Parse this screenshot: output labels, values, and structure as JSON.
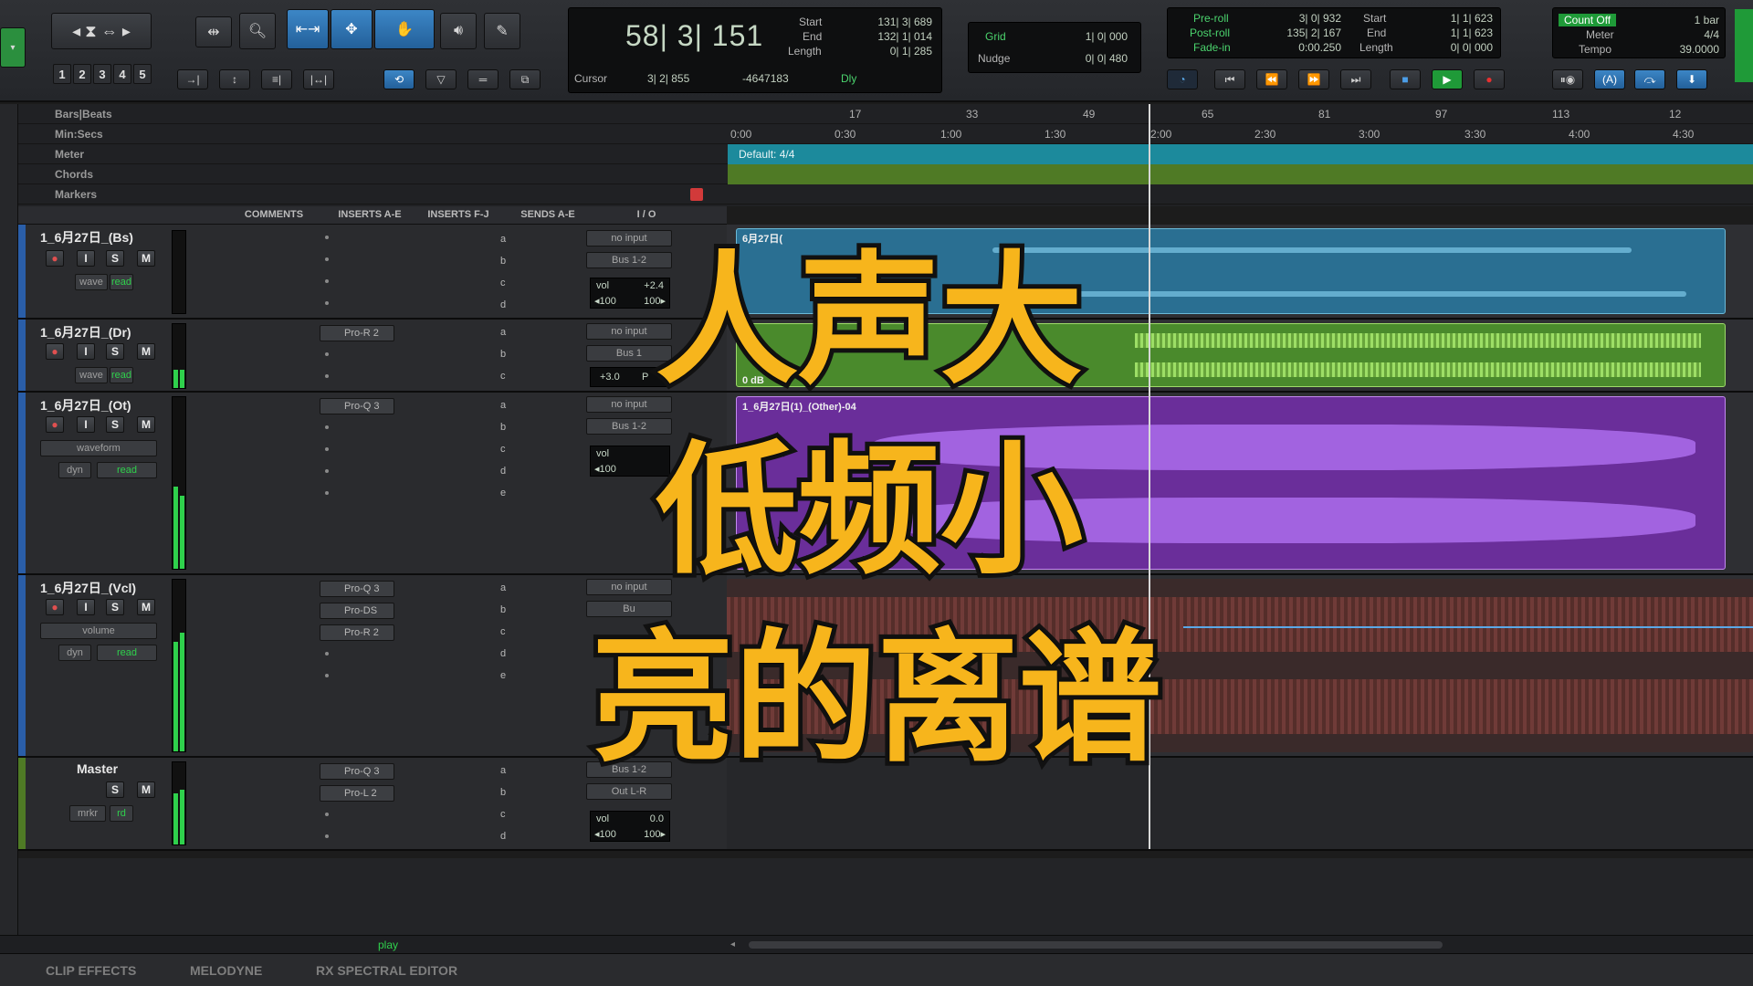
{
  "toolbar": {
    "numbers": [
      "1",
      "2",
      "3",
      "4",
      "5"
    ],
    "main_counter": "58| 3| 151",
    "start_label": "Start",
    "end_label": "End",
    "length_label": "Length",
    "start_value": "131| 3| 689",
    "end_value": "132| 1| 014",
    "length_value": "0| 1| 285",
    "cursor_label": "Cursor",
    "cursor_value": "3| 2| 855",
    "cursor_extra": "-4647183",
    "dly_label": "Dly",
    "grid_label": "Grid",
    "grid_value": "1| 0| 000",
    "nudge_label": "Nudge",
    "nudge_value": "0| 0| 480",
    "preroll_label": "Pre-roll",
    "preroll_value": "3| 0| 932",
    "postroll_label": "Post-roll",
    "postroll_value": "135| 2| 167",
    "fadein_label": "Fade-in",
    "fadein_value": "0:00.250",
    "start2_label": "Start",
    "start2_value": "1| 1| 623",
    "end2_label": "End",
    "end2_value": "1| 1| 623",
    "length2_label": "Length",
    "length2_value": "0| 0| 000",
    "count_off": "Count Off",
    "bar_value": "1 bar",
    "meter_label": "Meter",
    "meter_value": "4/4",
    "tempo_label": "Tempo",
    "tempo_value": "39.0000"
  },
  "rulers": {
    "bars_beats": "Bars|Beats",
    "min_secs": "Min:Secs",
    "meter": "Meter",
    "chords": "Chords",
    "markers": "Markers",
    "bar_ticks": [
      "17",
      "33",
      "49",
      "65",
      "81",
      "97",
      "113",
      "12"
    ],
    "time_ticks": [
      "0:00",
      "0:30",
      "1:00",
      "1:30",
      "2:00",
      "2:30",
      "3:00",
      "3:30",
      "4:00",
      "4:30"
    ],
    "meter_default": "Default: 4/4"
  },
  "columns": {
    "comments": "COMMENTS",
    "inserts_ae": "INSERTS A-E",
    "inserts_fj": "INSERTS F-J",
    "sends_ae": "SENDS A-E",
    "io": "I / O"
  },
  "sends": [
    "a",
    "b",
    "c",
    "d",
    "e"
  ],
  "tracks": [
    {
      "name": "1_6月27日_(Bs)",
      "view": "wave",
      "auto": "read",
      "inserts": [],
      "io_in": "no input",
      "io_out": "Bus 1-2",
      "vol_label": "vol",
      "vol": "+2.4",
      "pan_l": "◂100",
      "pan_r": "100▸",
      "clip": "6月27日(",
      "color": "#3a92b8"
    },
    {
      "name": "1_6月27日_(Dr)",
      "view": "wave",
      "auto": "read",
      "inserts": [
        "Pro-R 2"
      ],
      "io_in": "no input",
      "io_out": "Bus 1",
      "vol": "+3.0",
      "pan": "P",
      "clip": "0 dB",
      "color": "#6fb53a"
    },
    {
      "name": "1_6月27日_(Ot)",
      "view": "waveform",
      "view2": "dyn",
      "auto": "read",
      "inserts": [
        "Pro-Q 3"
      ],
      "io_in": "no input",
      "io_out": "Bus 1-2",
      "vol_label": "vol",
      "pan_l": "◂100",
      "clip": "1_6月27日(1)_(Other)-04",
      "color": "#9a52d6"
    },
    {
      "name": "1_6月27日_(Vcl)",
      "view": "volume",
      "view2": "dyn",
      "auto": "read",
      "inserts": [
        "Pro-Q 3",
        "Pro-DS",
        "Pro-R 2"
      ],
      "io_in": "no input",
      "io_out": "Bu",
      "color": "#7a3e3a"
    },
    {
      "name": "Master",
      "view": "mrkr",
      "auto": "rd",
      "inserts": [
        "Pro-Q 3",
        "Pro-L 2"
      ],
      "io_in": "Bus 1-2",
      "io_out": "Out L-R",
      "vol_label": "vol",
      "vol": "0.0",
      "pan_l": "◂100",
      "pan_r": "100▸"
    }
  ],
  "bottom": {
    "play": "play"
  },
  "tabs": [
    "CLIP EFFECTS",
    "MELODYNE",
    "RX SPECTRAL EDITOR"
  ],
  "caption": [
    "人声大",
    "低频小",
    "亮的离谱"
  ]
}
